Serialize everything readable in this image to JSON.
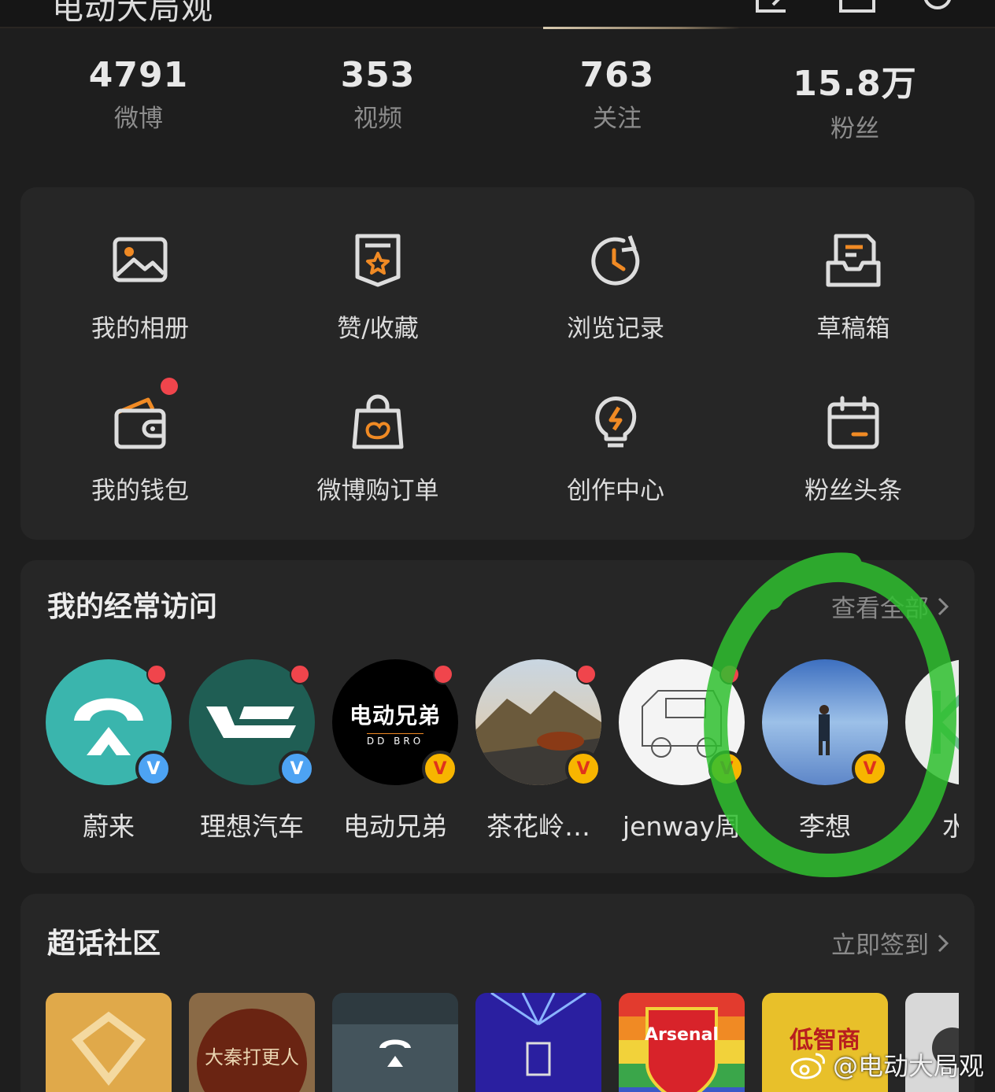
{
  "header": {
    "title": "电动大局观"
  },
  "stats": [
    {
      "value": "4791",
      "label": "微博"
    },
    {
      "value": "353",
      "label": "视频"
    },
    {
      "value": "763",
      "label": "关注"
    },
    {
      "value": "15.8万",
      "label": "粉丝"
    }
  ],
  "tools": [
    {
      "label": "我的相册",
      "icon": "photo-album-icon"
    },
    {
      "label": "赞/收藏",
      "icon": "bookmark-star-icon"
    },
    {
      "label": "浏览记录",
      "icon": "history-clock-icon"
    },
    {
      "label": "草稿箱",
      "icon": "draft-box-icon"
    },
    {
      "label": "我的钱包",
      "icon": "wallet-icon"
    },
    {
      "label": "微博购订单",
      "icon": "shopping-bag-icon"
    },
    {
      "label": "创作中心",
      "icon": "lightbulb-icon"
    },
    {
      "label": "粉丝头条",
      "icon": "calendar-icon"
    }
  ],
  "frequent": {
    "title": "我的经常访问",
    "link": "查看全部",
    "items": [
      {
        "name": "蔚来",
        "badge": "V"
      },
      {
        "name": "理想汽车",
        "badge": "V"
      },
      {
        "name": "电动兄弟",
        "badge": "V",
        "logo_main": "电动兄弟",
        "logo_sub": "DD BRO"
      },
      {
        "name": "茶花岭…",
        "badge": "V"
      },
      {
        "name": "jenway周",
        "badge": "V"
      },
      {
        "name": "李想",
        "badge": "V"
      },
      {
        "name": "水水"
      }
    ]
  },
  "supertopic": {
    "title": "超话社区",
    "link": "立即签到",
    "tiles": [
      {
        "label": ""
      },
      {
        "label": "大秦打更人"
      },
      {
        "label": ""
      },
      {
        "label": ""
      },
      {
        "label": "Arsenal"
      },
      {
        "label": "低智商"
      },
      {
        "label": ""
      }
    ]
  },
  "watermark": "@电动大局观",
  "colors": {
    "accent_orange": "#f08a24",
    "red_dot": "#f0454c",
    "verified_blue": "#4da3f3",
    "verified_gold": "#f7b500",
    "annotation_green": "#2fbf2f"
  }
}
